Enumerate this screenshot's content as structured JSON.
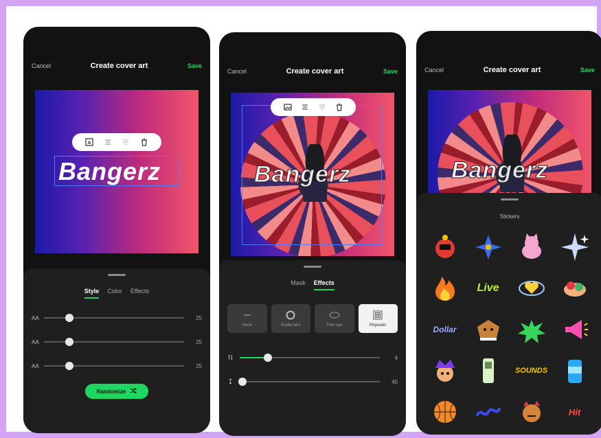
{
  "screens": [
    {
      "topbar": {
        "cancel": "Cancel",
        "title": "Create cover art",
        "save": "Save"
      },
      "cover_text": "Bangerz",
      "tabs": [
        {
          "label": "Style",
          "active": true
        },
        {
          "label": "Color",
          "active": false
        },
        {
          "label": "Effects",
          "active": false
        }
      ],
      "sliders": [
        {
          "label": "AA",
          "value": "25",
          "position": 0.18
        },
        {
          "label": "AA",
          "value": "25",
          "position": 0.18
        },
        {
          "label": "AA",
          "value": "25",
          "position": 0.18
        }
      ],
      "randomize_label": "Randomize"
    },
    {
      "topbar": {
        "cancel": "Cancel",
        "title": "Create cover art",
        "save": "Save"
      },
      "cover_text": "Bangerz",
      "tabs": [
        {
          "label": "Mask",
          "active": false
        },
        {
          "label": "Effects",
          "active": true
        }
      ],
      "effects": [
        {
          "name": "None",
          "active": false
        },
        {
          "name": "Radial blur",
          "active": false
        },
        {
          "name": "Fish eye",
          "active": false
        },
        {
          "name": "Repeater",
          "active": true
        }
      ],
      "sliders": [
        {
          "value": "4",
          "position": 0.2
        },
        {
          "value": "40",
          "position": 0.02
        }
      ]
    },
    {
      "topbar": {
        "cancel": "Cancel",
        "title": "Create cover art",
        "save": "Save"
      },
      "cover_text": "Bangerz",
      "stickers_title": "Stickers",
      "stickers": [
        {
          "icon": "robot-face-icon"
        },
        {
          "icon": "blue-flower-icon"
        },
        {
          "icon": "pink-cat-icon"
        },
        {
          "icon": "sparkle-icon"
        },
        {
          "icon": "fire-icon"
        },
        {
          "text": "Live"
        },
        {
          "icon": "heart-orbit-icon"
        },
        {
          "icon": "hands-hug-icon"
        },
        {
          "text": "Dollar"
        },
        {
          "icon": "dog-face-icon"
        },
        {
          "icon": "green-splat-icon"
        },
        {
          "icon": "megaphone-icon"
        },
        {
          "icon": "jester-face-icon"
        },
        {
          "icon": "phone-icon"
        },
        {
          "text": "SOUNDS"
        },
        {
          "icon": "soda-can-icon"
        },
        {
          "icon": "basketball-icon"
        },
        {
          "icon": "squiggle-icon"
        },
        {
          "icon": "devil-face-icon"
        },
        {
          "text": "Hit"
        }
      ]
    }
  ],
  "colors": {
    "accent": "#1ed760",
    "background": "#121212",
    "sheet": "#1f1f1f",
    "selection": "#4f79ff"
  }
}
